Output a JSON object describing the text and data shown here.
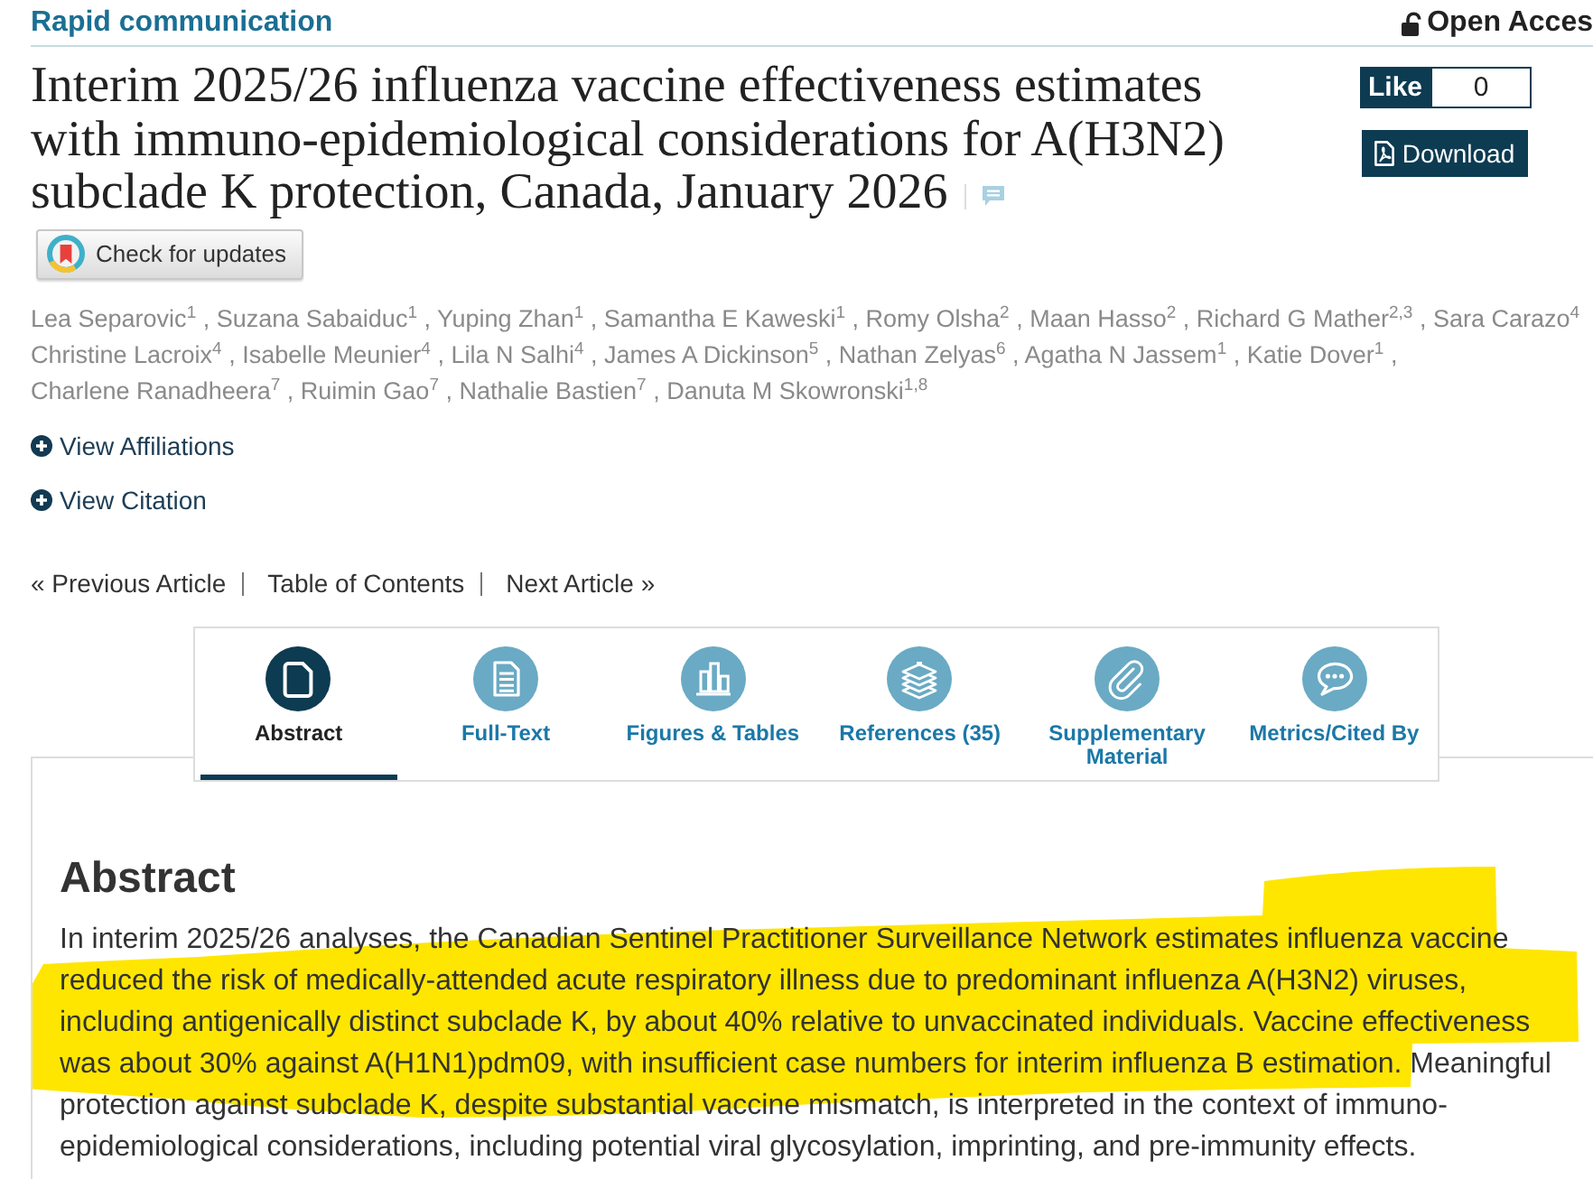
{
  "header": {
    "section": "Rapid communication",
    "access": "Open Acces"
  },
  "title_lines": [
    "Interim 2025/26 influenza vaccine effectiveness estimates",
    "with immuno-epidemiological considerations for A(H3N2)",
    "subclade K protection, Canada, January 2026"
  ],
  "like": {
    "label": "Like",
    "count": "0"
  },
  "download": {
    "label": "Download"
  },
  "updates": {
    "label": "Check for updates"
  },
  "authors": [
    "Lea Separovic$^{1}$ , Suzana Sabaiduc$^{1}$ , Yuping Zhan$^{1}$ , Samantha E Kaweski$^{1}$ , Romy Olsha$^{2}$ , Maan Hasso$^{2}$ , Richard G Mather$^{2,3}$ , Sara Carazo$^{4}$",
    "Christine Lacroix$^{4}$ , Isabelle Meunier$^{4}$ , Lila N Salhi$^{4}$ , James A Dickinson$^{5}$ , Nathan Zelyas$^{6}$ , Agatha N Jassem$^{1}$ , Katie Dover$^{1}$ ,",
    "Charlene Ranadheera$^{7}$ , Ruimin Gao$^{7}$ , Nathalie Bastien$^{7}$ , Danuta M Skowronski$^{1,8}$"
  ],
  "expand_links": [
    {
      "label": "View Affiliations"
    },
    {
      "label": "View Citation"
    }
  ],
  "article_nav": [
    {
      "label": "« Previous Article"
    },
    {
      "label": "Table of Contents"
    },
    {
      "label": "Next Article »"
    }
  ],
  "tabs": [
    {
      "label": "Abstract",
      "kind": "document",
      "selected": true
    },
    {
      "label": "Full-Text",
      "kind": "text",
      "selected": false
    },
    {
      "label": "Figures & Tables",
      "kind": "figures",
      "selected": false
    },
    {
      "label": "References (35)",
      "kind": "references",
      "selected": false
    },
    {
      "label": "Supplementary Material",
      "kind": "attachment",
      "selected": false
    },
    {
      "label": "Metrics/Cited By",
      "kind": "comments",
      "selected": false
    }
  ],
  "abstract": {
    "heading": "Abstract",
    "text": "In interim 2025/26 analyses, the Canadian Sentinel Practitioner Surveillance Network estimates influenza vaccine reduced the risk of medically-attended acute respiratory illness due to predominant influenza A(H3N2) viruses, including antigenically distinct subclade K, by about 40% relative to unvaccinated individuals. Vaccine effectiveness was about 30% against A(H1N1)pdm09, with insufficient case numbers for interim influenza B estimation. Meaningful protection against subclade K, despite substantial vaccine mismatch, is interpreted in the context of immuno-epidemiological considerations, including potential viral glycosylation, imprinting, and pre-immunity effects.",
    "highlighted": true
  }
}
